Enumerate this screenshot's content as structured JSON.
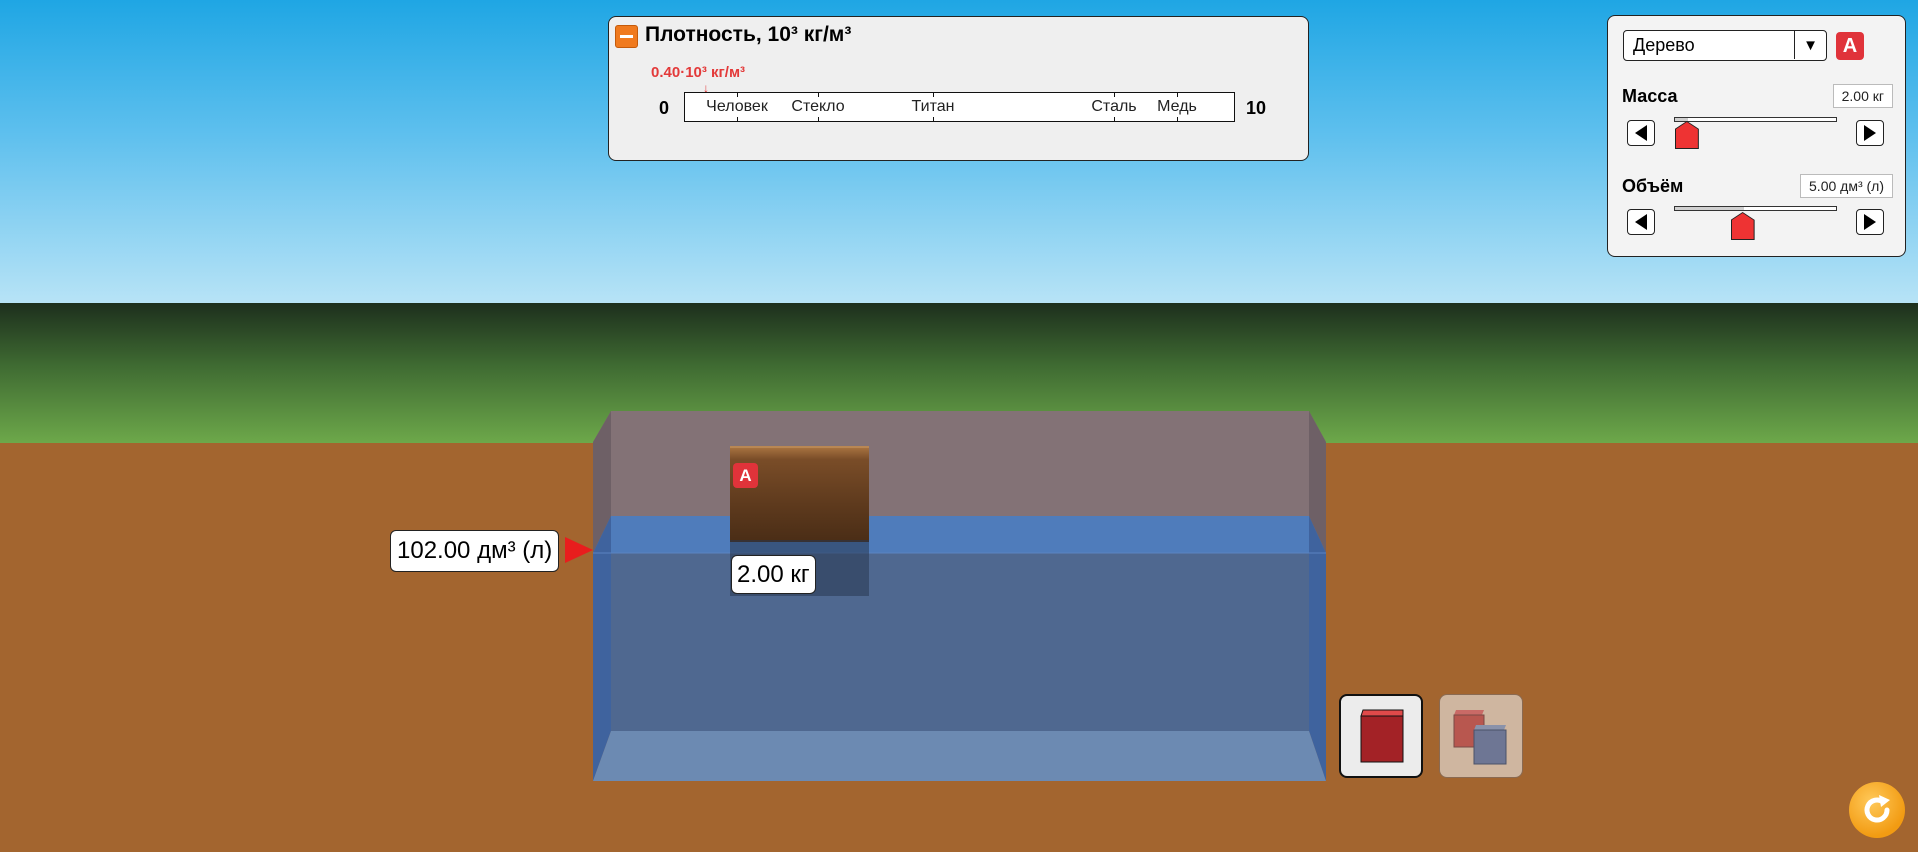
{
  "scene": {
    "water_volume_label": "102.00 дм³ (л)",
    "block": {
      "badge": "A",
      "mass_label": "2.00 кг"
    }
  },
  "density_panel": {
    "title": "Плотность, 10³ кг/м³",
    "marker_value": "0.40·10³ кг/м³",
    "scale_min": "0",
    "scale_max": "10",
    "labels": [
      "Человек",
      "Стекло",
      "Титан",
      "Сталь",
      "Медь"
    ]
  },
  "controls": {
    "material": "Дерево",
    "badge": "A",
    "mass": {
      "label": "Масса",
      "value": "2.00 кг",
      "level": 0.02
    },
    "volume": {
      "label": "Объём",
      "value": "5.00 дм³ (л)",
      "level": 0.41
    }
  },
  "icons": {
    "collapse": "minus-icon",
    "dropdown": "triangle-down-icon",
    "step_left": "triangle-left-icon",
    "step_right": "triangle-right-icon",
    "reset": "refresh-icon"
  },
  "colors": {
    "accent_red": "#e0333a",
    "water": "#4a6fa8",
    "ground": "#a3652f"
  }
}
